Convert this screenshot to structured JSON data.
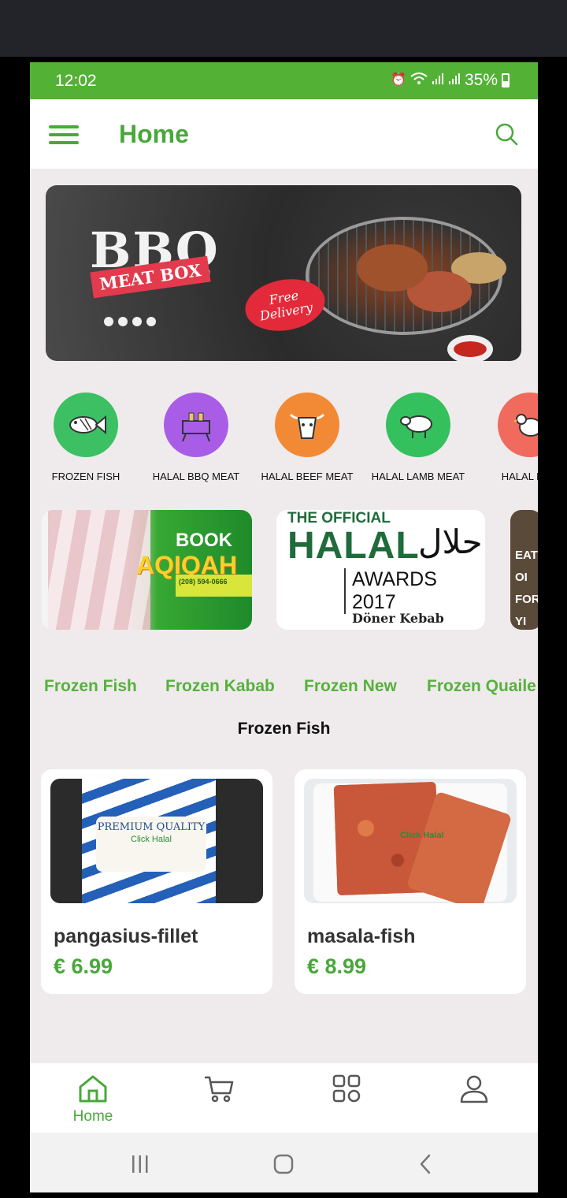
{
  "status_bar": {
    "time": "12:02",
    "battery": "35%",
    "icons": [
      "alarm-icon",
      "wifi-icon",
      "signal-icon",
      "signal-icon",
      "battery-icon"
    ]
  },
  "app_bar": {
    "title": "Home",
    "menu_icon": "hamburger-menu-icon",
    "search_icon": "search-icon"
  },
  "hero_banner": {
    "heading": "BBQ",
    "subheading": "MEAT BOX",
    "badge": "Free Delivery"
  },
  "categories": [
    {
      "label": "FROZEN FISH",
      "color": "#3dbf63",
      "icon": "fish-icon"
    },
    {
      "label": "HALAL BBQ MEAT",
      "color": "#a95de6",
      "icon": "bbq-icon"
    },
    {
      "label": "HALAL BEEF MEAT",
      "color": "#f28a35",
      "icon": "cow-icon"
    },
    {
      "label": "HALAL LAMB MEAT",
      "color": "#34c05c",
      "icon": "sheep-icon"
    },
    {
      "label": "HALAL POU",
      "color": "#f06a5e",
      "icon": "chicken-icon"
    }
  ],
  "promos": [
    {
      "line1": "BOOK",
      "line2": "AQIQAH",
      "phone": "(208) 594-0666"
    },
    {
      "line1": "THE OFFICIAL",
      "line2": "HALAL",
      "arabic": "حلال",
      "line3": "AWARDS 2017",
      "partner": "Döner Kebab"
    },
    {
      "text": "EAT OI FOR YI AND T"
    }
  ],
  "subcategory_tabs": [
    "Frozen Fish",
    "Frozen Kabab",
    "Frozen New",
    "Frozen Quaile"
  ],
  "section_title": "Frozen Fish",
  "products": [
    {
      "name": "pangasius-fillet",
      "price": "€ 6.99",
      "image_text": "PREMIUM QUALITY",
      "image_brand": "Click Halal"
    },
    {
      "name": "masala-fish",
      "price": "€ 8.99",
      "image_brand": "Click Halal"
    }
  ],
  "bottom_nav": [
    {
      "label": "Home",
      "icon": "home-icon",
      "active": true
    },
    {
      "label": "",
      "icon": "cart-icon",
      "active": false
    },
    {
      "label": "",
      "icon": "grid-icon",
      "active": false
    },
    {
      "label": "",
      "icon": "profile-icon",
      "active": false
    }
  ],
  "colors": {
    "primary": "#53b236",
    "accent_text": "#48a83a",
    "background": "#efebec"
  }
}
